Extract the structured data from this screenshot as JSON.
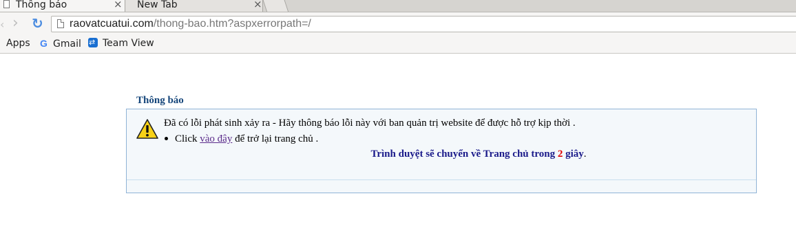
{
  "browser": {
    "tabs": [
      {
        "title": "Thông báo",
        "active": true
      },
      {
        "title": "New Tab",
        "active": false
      }
    ],
    "close_glyph": "×",
    "url_host": "raovatcuatui.com",
    "url_path": "/thong-bao.htm?aspxerrorpath=/",
    "bookmarks": [
      {
        "label": "Apps",
        "icon": "apps-grid-icon"
      },
      {
        "label": "Gmail",
        "icon": "google-g-icon"
      },
      {
        "label": "Team View",
        "icon": "teamviewer-icon"
      }
    ]
  },
  "page": {
    "heading": "Thông báo",
    "error_message": "Đã có lỗi phát sinh xảy ra - Hãy thông báo lỗi này với ban quản trị website để được hỗ trợ kịp thời  .",
    "click_prefix": "Click",
    "click_link": "vào đây",
    "click_suffix": "để trở lại trang chủ .",
    "redirect_prefix": "Trình duyệt sẽ chuyển về Trang chủ trong",
    "redirect_seconds": "2",
    "redirect_suffix": "giây",
    "redirect_end": "."
  },
  "colors": {
    "heading": "#14457a",
    "panel_border": "#8fb3d6",
    "panel_bg": "#f4f8fb",
    "link": "#5a2a8a",
    "redirect_text": "#1a1a8a",
    "countdown": "#e00000",
    "warning_yellow": "#f7d117"
  }
}
